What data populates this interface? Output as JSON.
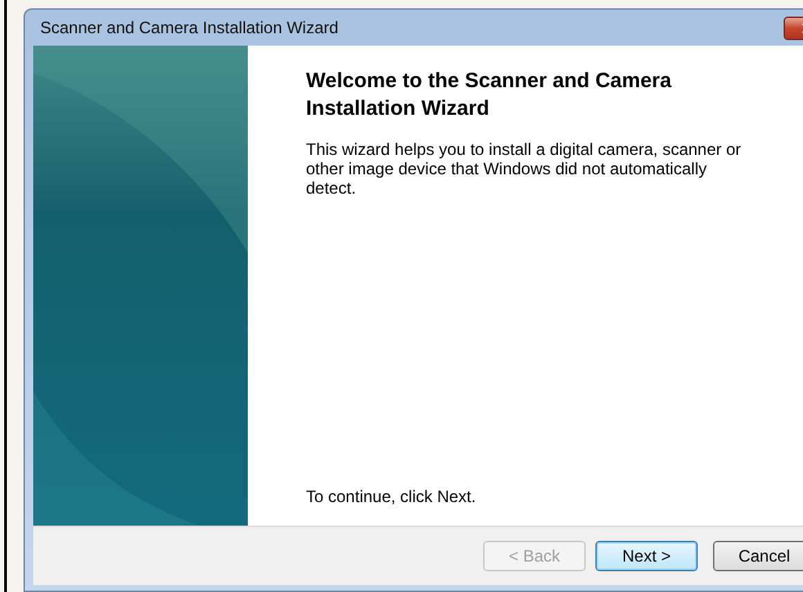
{
  "window": {
    "title": "Scanner and Camera Installation Wizard"
  },
  "heading": "Welcome to the Scanner and Camera Installation Wizard",
  "description": "This wizard helps you to install a digital camera, scanner or other image device that Windows did not automatically detect.",
  "footer_text": "To continue, click Next.",
  "buttons": [
    {
      "label": "< Back",
      "disabled": true,
      "default": false
    },
    {
      "label": "Next >",
      "disabled": false,
      "default": true
    },
    {
      "label": "Cancel",
      "disabled": false,
      "default": false
    }
  ]
}
